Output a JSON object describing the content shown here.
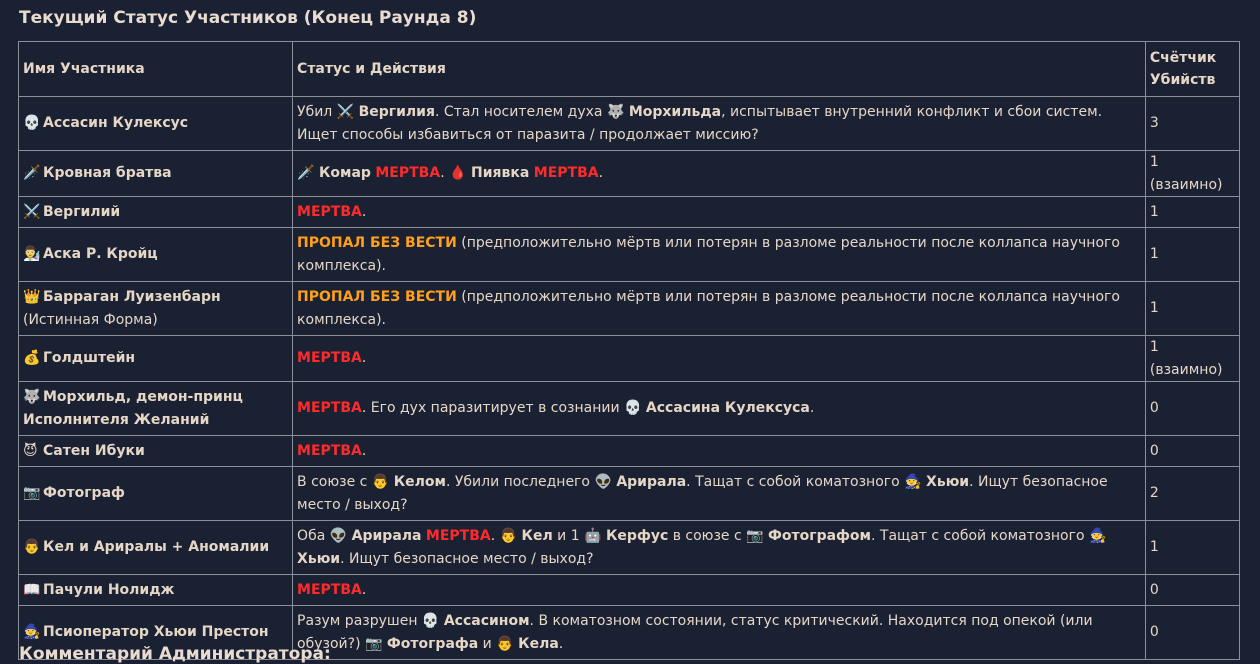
{
  "title": "Текущий Статус Участников (Конец Раунда 8)",
  "bottom_title": "Комментарий Администратора:",
  "headers": {
    "name": "Имя Участника",
    "status": "Статус и Действия",
    "kills": "Счётчик Убийств"
  },
  "words": {
    "dead": "МЕРТВА",
    "missing": "ПРОПАЛ БЕЗ ВЕСТИ"
  },
  "rows": [
    {
      "icon": "💀",
      "name": "Ассасин Кулексус",
      "s": [
        "Убил ",
        "⚔️",
        " ",
        "Вергилия",
        ". Стал носителем духа ",
        "🐺",
        " ",
        "Морхильда",
        ", испытывает внутренний конфликт и сбои систем. Ищет способы избавиться от паразита / продолжает миссию?"
      ],
      "kills": "3"
    },
    {
      "icon": "🗡️",
      "name": "Кровная братва",
      "s": [
        "🗡️",
        " ",
        "Комар",
        " ",
        "МЕРТВА",
        ". ",
        "🩸",
        " ",
        "Пиявка",
        " ",
        "МЕРТВА",
        "."
      ],
      "kills": "1 (взаимно)"
    },
    {
      "icon": "⚔️",
      "name": "Вергилий",
      "s": [
        "МЕРТВА",
        "."
      ],
      "kills": "1"
    },
    {
      "icon": "👨‍🔬",
      "name": "Аска Р. Кройц",
      "s": [
        "ПРОПАЛ БЕЗ ВЕСТИ",
        " (предположительно мёртв или потерян в разломе реальности после коллапса научного комплекса)."
      ],
      "kills": "1"
    },
    {
      "icon": "👑",
      "name": "Барраган Луизенбарн",
      "name_sub": "(Истинная Форма)",
      "s": [
        "ПРОПАЛ БЕЗ ВЕСТИ",
        " (предположительно мёртв или потерян в разломе реальности после коллапса научного комплекса)."
      ],
      "kills": "1"
    },
    {
      "icon": "💰",
      "name": "Голдштейн",
      "s": [
        "МЕРТВА",
        "."
      ],
      "kills": "1 (взаимно)"
    },
    {
      "icon": "🐺",
      "name": "Морхильд, демон-принц Исполнителя Желаний",
      "s": [
        "МЕРТВА",
        ". Его дух паразитирует в сознании ",
        "💀",
        " ",
        "Ассасина Кулексуса",
        "."
      ],
      "kills": "0"
    },
    {
      "icon": "😈",
      "name": "Сатен Ибуки",
      "s": [
        "МЕРТВА",
        "."
      ],
      "kills": "0"
    },
    {
      "icon": "📷",
      "name": "Фотограф",
      "s": [
        "В союзе с ",
        "👨",
        " ",
        "Келом",
        ". Убили последнего ",
        "👽",
        " ",
        "Арирала",
        ". Тащат с собой коматозного ",
        "🧙",
        " ",
        "Хьюи",
        ". Ищут безопасное место / выход?"
      ],
      "kills": "2"
    },
    {
      "icon": "👨",
      "name": "Кел и Арирaлы + Аномалии",
      "s": [
        "Оба ",
        "👽",
        " ",
        "Арирала",
        " ",
        "МЕРТВА",
        ". ",
        "👨",
        " ",
        "Кел",
        " и 1 ",
        "🤖",
        " ",
        "Керфус",
        " в союзе с ",
        "📷",
        " ",
        "Фотографом",
        ". Тащат с собой коматозного ",
        "🧙",
        " ",
        "Хьюи",
        ". Ищут безопасное место / выход?"
      ],
      "kills": "1"
    },
    {
      "icon": "📖",
      "name": "Пачули Нолидж",
      "s": [
        "МЕРТВА",
        "."
      ],
      "kills": "0"
    },
    {
      "icon": "🧙",
      "name": "Псиоператор Хьюи Престон",
      "s": [
        "Разум разрушен ",
        "💀",
        " ",
        "Ассасином",
        ". В коматозном состоянии, статус критический. Находится под опекой (или обузой?) ",
        "📷",
        " ",
        "Фотографа",
        " и ",
        "👨",
        " ",
        "Кела",
        "."
      ],
      "kills": "0"
    }
  ]
}
